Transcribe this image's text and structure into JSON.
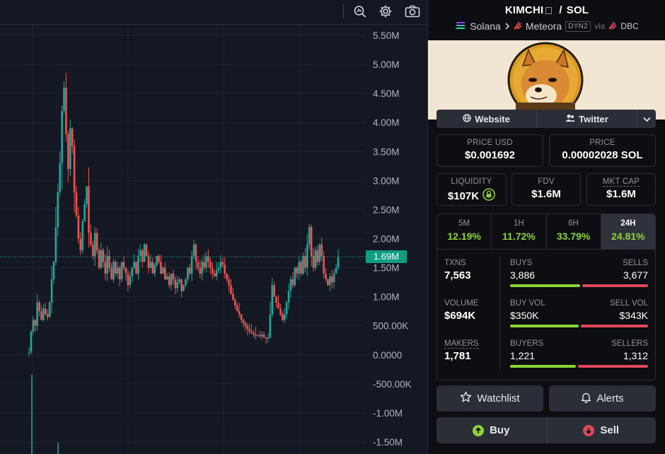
{
  "colors": {
    "up": "#26a69a",
    "down": "#ef5350",
    "accent_green": "#8dd33a",
    "accent_red": "#e0485a",
    "price_tag": "#0f9c80"
  },
  "chart": {
    "toolbar_icons": [
      "indicator-search-icon",
      "settings-icon",
      "camera-icon"
    ],
    "current_price_label": "1.69M"
  },
  "chart_data": {
    "type": "candlestick",
    "y_ticks": [
      "5.50M",
      "5.00M",
      "4.50M",
      "4.00M",
      "3.50M",
      "3.00M",
      "2.50M",
      "2.00M",
      "1.50M",
      "1.00M",
      "500.00K",
      "0.0000",
      "-500.00K",
      "-1.00M",
      "-1.50M"
    ],
    "ylim": [
      -1600000,
      5700000
    ],
    "current_value": 1690000,
    "close_series": [
      0.05,
      0.4,
      0.6,
      0.5,
      0.9,
      0.75,
      0.6,
      0.8,
      0.7,
      0.65,
      0.9,
      1.3,
      1.6,
      2.2,
      2.8,
      3.3,
      4.2,
      4.6,
      3.8,
      3.2,
      3.9,
      3.6,
      2.8,
      2.4,
      2.0,
      1.8,
      2.3,
      2.6,
      2.9,
      2.1,
      1.9,
      1.7,
      2.1,
      1.8,
      1.5,
      1.8,
      1.6,
      1.4,
      1.7,
      1.5,
      1.3,
      1.6,
      1.4,
      1.5,
      1.3,
      1.6,
      1.5,
      1.4,
      1.2,
      1.35,
      1.5,
      1.6,
      1.4,
      1.7,
      1.8,
      1.6,
      1.9,
      1.7,
      1.5,
      1.6,
      1.4,
      1.55,
      1.7,
      1.6,
      1.4,
      1.5,
      1.3,
      1.35,
      1.2,
      1.4,
      1.3,
      1.15,
      1.25,
      1.3,
      1.1,
      1.2,
      1.3,
      1.5,
      1.4,
      1.7,
      1.9,
      1.6,
      1.5,
      1.4,
      1.6,
      1.5,
      1.7,
      1.6,
      1.5,
      1.4,
      1.35,
      1.45,
      1.5,
      1.6,
      1.55,
      1.4,
      1.3,
      1.2,
      1.05,
      0.95,
      0.85,
      0.75,
      0.7,
      0.6,
      0.55,
      0.5,
      0.45,
      0.4,
      0.38,
      0.35,
      0.33,
      0.34,
      0.32,
      0.35,
      0.3,
      0.28,
      0.3,
      0.7,
      1.2,
      1.0,
      0.9,
      0.8,
      0.7,
      0.6,
      0.7,
      0.9,
      1.1,
      1.3,
      1.2,
      1.5,
      1.4,
      1.6,
      1.4,
      1.7,
      1.5,
      1.9,
      2.2,
      1.7,
      1.5,
      1.8,
      1.6,
      1.9,
      1.7,
      1.4,
      1.3,
      1.2,
      1.35,
      1.25,
      1.4,
      1.5,
      1.69
    ]
  },
  "pair": {
    "base": "KIMCHI",
    "separator": "/",
    "quote": "SOL",
    "chain": "Solana",
    "dex": "Meteora",
    "dex_badge": "DYN2",
    "via": "via",
    "via_source": "DBC"
  },
  "links": {
    "website": "Website",
    "twitter": "Twitter"
  },
  "prices": {
    "usd_label": "PRICE USD",
    "usd_value": "$0.001692",
    "native_label": "PRICE",
    "native_value": "0.00002028 SOL"
  },
  "metrics": {
    "liquidity_label": "LIQUIDITY",
    "liquidity_value": "$107K",
    "fdv_label": "FDV",
    "fdv_value": "$1.6M",
    "mktcap_label": "MKT CAP",
    "mktcap_value": "$1.6M"
  },
  "timeframes": [
    {
      "label": "5M",
      "change": "12.19%"
    },
    {
      "label": "1H",
      "change": "11.72%"
    },
    {
      "label": "6H",
      "change": "33.79%"
    },
    {
      "label": "24H",
      "change": "24.81%"
    }
  ],
  "stats": {
    "txns_label": "TXNS",
    "txns_value": "7,563",
    "buys_label": "BUYS",
    "buys_value": "3,886",
    "sells_label": "SELLS",
    "sells_value": "3,677",
    "buys_fraction": 0.514,
    "volume_label": "VOLUME",
    "volume_value": "$694K",
    "buyvol_label": "BUY VOL",
    "buyvol_value": "$350K",
    "sellvol_label": "SELL VOL",
    "sellvol_value": "$343K",
    "buyvol_fraction": 0.505,
    "makers_label": "MAKERS",
    "makers_value": "1,781",
    "buyers_label": "BUYERS",
    "buyers_value": "1,221",
    "sellers_label": "SELLERS",
    "sellers_value": "1,312",
    "buyers_fraction": 0.482
  },
  "actions": {
    "watchlist": "Watchlist",
    "alerts": "Alerts",
    "buy": "Buy",
    "sell": "Sell"
  }
}
